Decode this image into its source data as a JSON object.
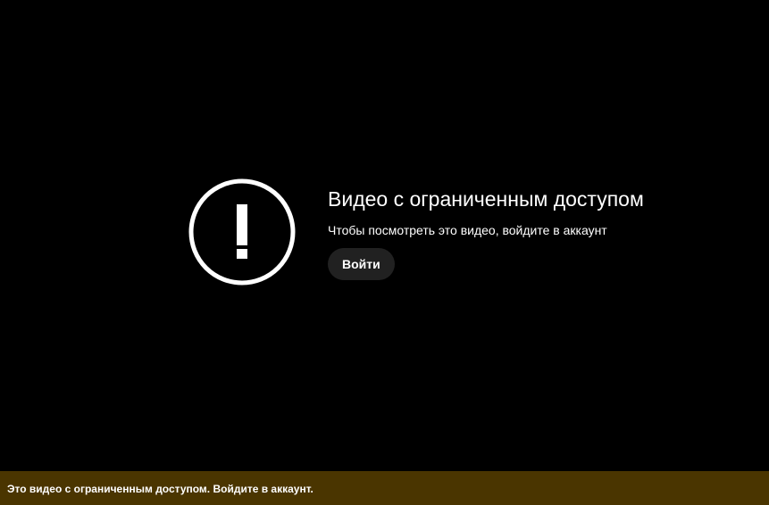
{
  "error": {
    "icon": "exclamation-circle-icon",
    "title": "Видео с ограниченным доступом",
    "subtitle": "Чтобы посмотреть это видео, войдите в аккаунт",
    "signin_label": "Войти"
  },
  "notice": {
    "text": "Это видео с ограниченным доступом. Войдите в аккаунт."
  },
  "colors": {
    "background": "#000000",
    "button": "#212121",
    "notice_bar": "#4a3500",
    "text": "#ffffff"
  }
}
